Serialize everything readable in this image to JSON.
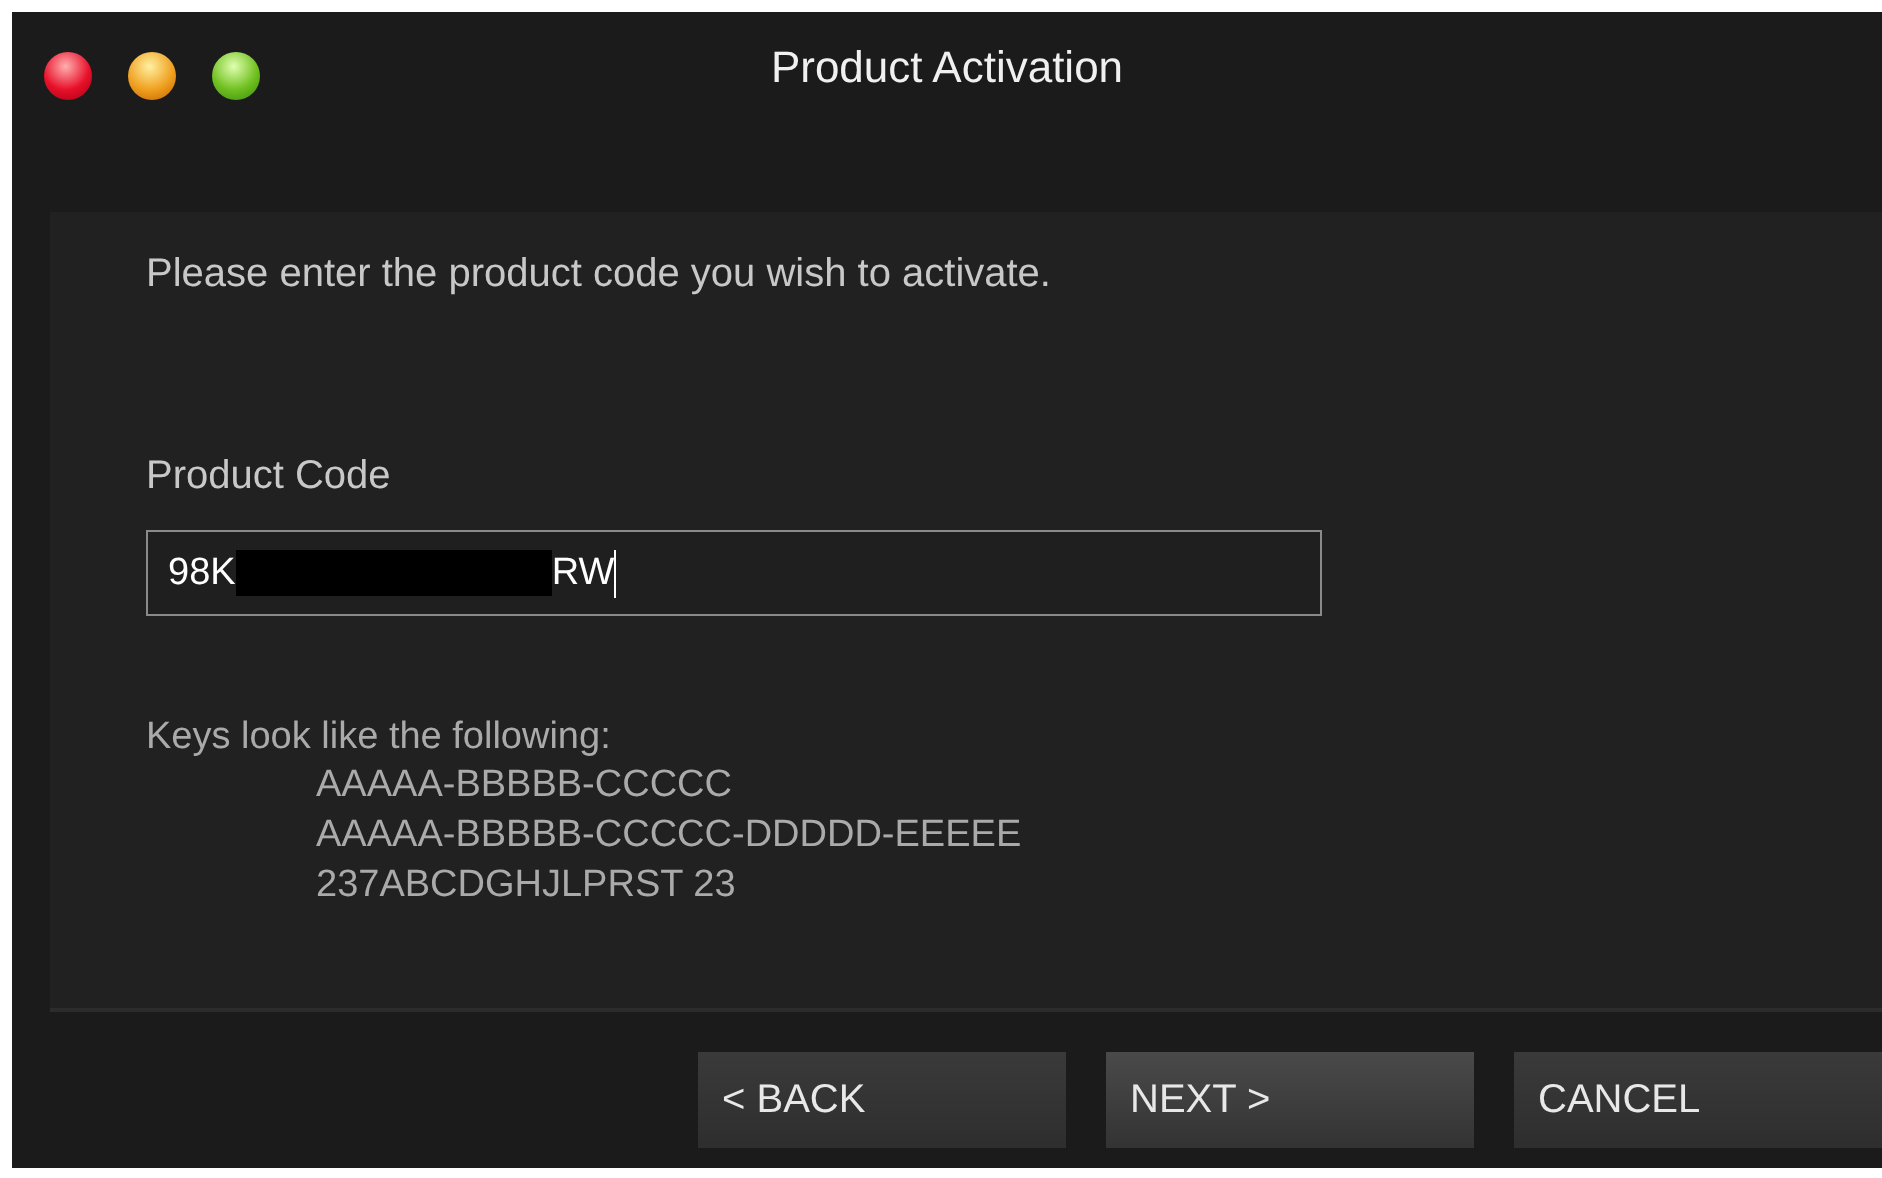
{
  "window": {
    "title": "Product Activation"
  },
  "prompt": "Please enter the product code you wish to activate.",
  "product_code": {
    "label": "Product Code",
    "value_start": "98K",
    "value_end": "RW",
    "redacted": true
  },
  "hint": {
    "heading": "Keys look like the following:",
    "examples": [
      "AAAAA-BBBBB-CCCCC",
      "AAAAA-BBBBB-CCCCC-DDDDD-EEEEE",
      "237ABCDGHJLPRST 23"
    ]
  },
  "buttons": [
    {
      "label": "< BACK",
      "kind": "back"
    },
    {
      "label": "NEXT >",
      "kind": "next"
    },
    {
      "label": "CANCEL",
      "kind": "cancel"
    }
  ]
}
